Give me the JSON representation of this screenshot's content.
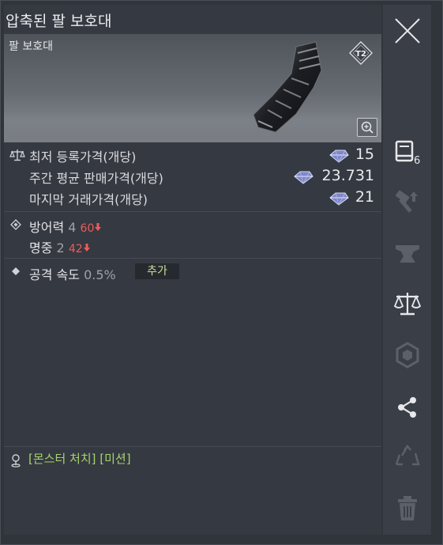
{
  "window": {
    "title": "압축된 팔 보호대"
  },
  "item": {
    "subtitle": "팔 보호대",
    "tier_label": "T2"
  },
  "prices": {
    "lowest_label": "최저 등록가격(개당)",
    "lowest_value": "15",
    "weekly_label": "주간 평균 판매가격(개당)",
    "weekly_value": "23.731",
    "last_label": "마지막 거래가격(개당)",
    "last_value": "21"
  },
  "stats": {
    "defense_label": "방어력",
    "defense_value": "4",
    "defense_compare": "60",
    "accuracy_label": "명중",
    "accuracy_value": "2",
    "accuracy_compare": "42",
    "attack_speed_label": "공격 속도",
    "attack_speed_value": "0.5%",
    "extra_tag": "추가"
  },
  "source": {
    "text": "[몬스터 처치] [미션]"
  },
  "sidebar": {
    "items": [
      {
        "icon": "close-icon"
      },
      {
        "icon": "book-icon",
        "badge": "6"
      },
      {
        "icon": "hammer-upgrade-icon"
      },
      {
        "icon": "anvil-icon"
      },
      {
        "icon": "scale-icon"
      },
      {
        "icon": "gem-socket-icon"
      },
      {
        "icon": "share-icon"
      },
      {
        "icon": "recycle-icon"
      },
      {
        "icon": "trash-icon"
      }
    ]
  },
  "colors": {
    "panel": "#30343b",
    "accent_green": "#a6d46f",
    "decrease_red": "#ef5a5a"
  }
}
